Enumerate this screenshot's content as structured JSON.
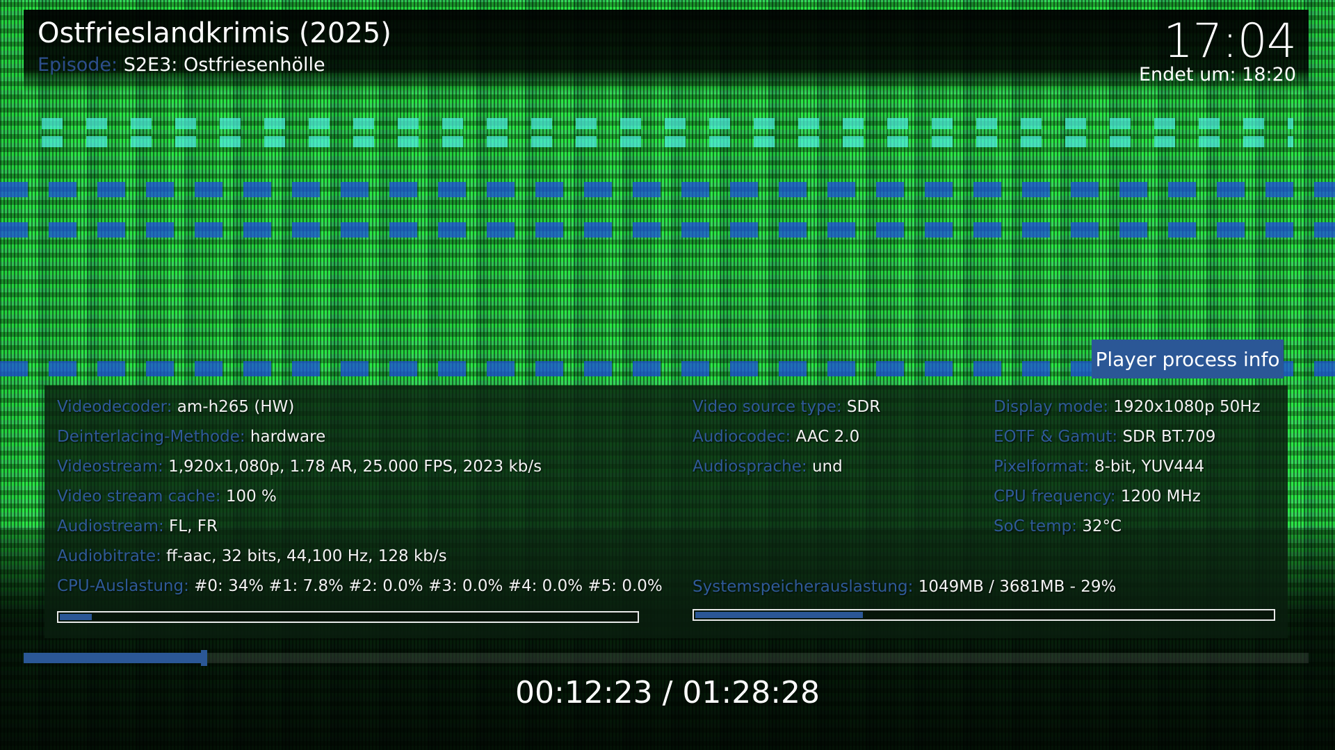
{
  "header": {
    "title": "Ostfrieslandkrimis (2025)",
    "episode_label": "Episode:",
    "episode_value": "S2E3: Ostfriesenhölle",
    "clock": "17:04",
    "ends_at": "Endet um: 18:20"
  },
  "panel": {
    "tab_label": "Player process info",
    "left_rows": [
      {
        "key": "Videodecoder:",
        "value": "am-h265 (HW)"
      },
      {
        "key": "Deinterlacing-Methode:",
        "value": "hardware"
      },
      {
        "key": "Videostream:",
        "value": "1,920x1,080p, 1.78 AR, 25.000 FPS, 2023 kb/s"
      },
      {
        "key": "Video stream cache:",
        "value": "100 %"
      },
      {
        "key": "Audiostream:",
        "value": "FL, FR"
      },
      {
        "key": "Audiobitrate:",
        "value": "ff-aac, 32 bits, 44,100 Hz, 128 kb/s"
      },
      {
        "key": "CPU-Auslastung:",
        "value": "#0:  34% #1: 7.8% #2: 0.0% #3: 0.0% #4: 0.0% #5: 0.0%"
      }
    ],
    "mid_rows": [
      {
        "key": "Video source type:",
        "value": "SDR"
      },
      {
        "key": "Audiocodec:",
        "value": "AAC  2.0"
      },
      {
        "key": "Audiosprache:",
        "value": "und"
      }
    ],
    "right_rows": [
      {
        "key": "Display mode:",
        "value": "1920x1080p 50Hz"
      },
      {
        "key": "EOTF & Gamut:",
        "value": "SDR BT.709"
      },
      {
        "key": "Pixelformat:",
        "value": "8-bit, YUV444"
      },
      {
        "key": "CPU frequency:",
        "value": "1200 MHz"
      },
      {
        "key": "SoC temp:",
        "value": "32°C"
      }
    ],
    "memory": {
      "key": "Systemspeicherauslastung:",
      "value": "1049MB / 3681MB - 29%"
    },
    "cpu_bar_fraction": 0.055,
    "mem_bar_fraction": 0.29
  },
  "playback": {
    "time": "00:12:23 / 01:28:28",
    "progress_fraction": 0.14
  },
  "colors": {
    "accent": "#2b5796",
    "label": "#2f5a98"
  }
}
